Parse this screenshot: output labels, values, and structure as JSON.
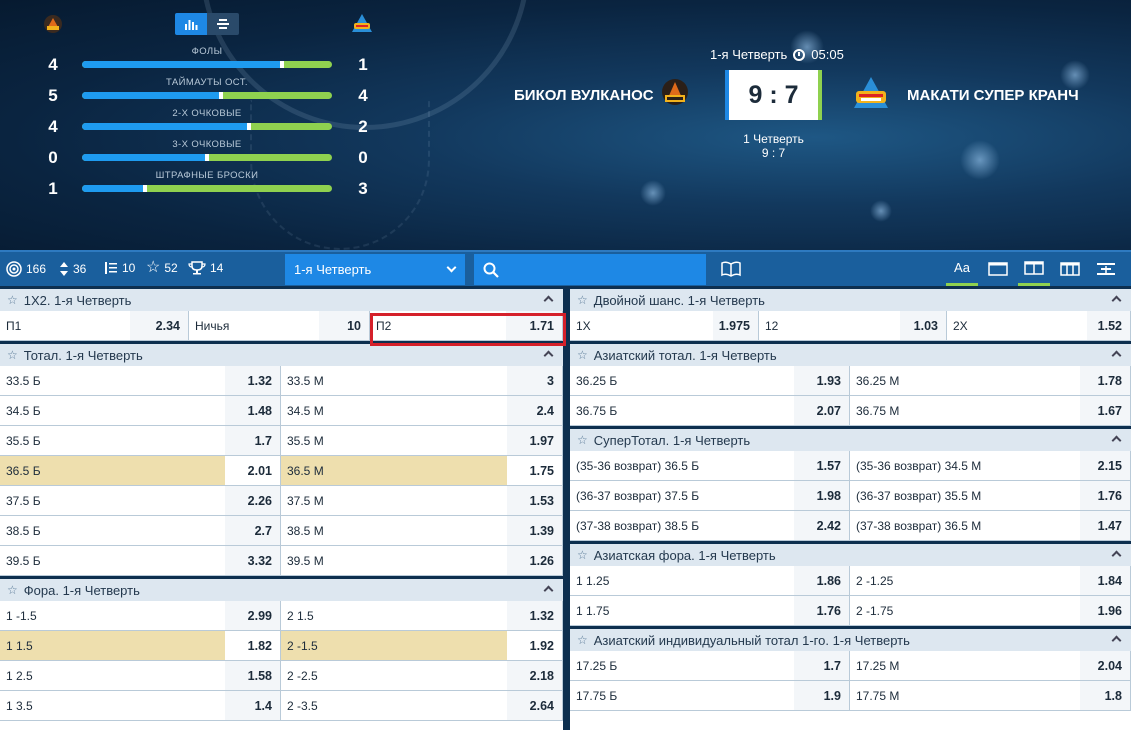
{
  "stats": [
    {
      "label": "ФОЛЫ",
      "left": "4",
      "right": "1",
      "split": 0.8
    },
    {
      "label": "ТАЙМАУТЫ ОСТ.",
      "left": "5",
      "right": "4",
      "split": 0.556
    },
    {
      "label": "2-Х ОЧКОВЫЕ",
      "left": "4",
      "right": "2",
      "split": 0.667
    },
    {
      "label": "3-Х ОЧКОВЫЕ",
      "left": "0",
      "right": "0",
      "split": 0.5
    },
    {
      "label": "ШТРАФНЫЕ БРОСКИ",
      "left": "1",
      "right": "3",
      "split": 0.25
    }
  ],
  "match": {
    "team_home": "БИКОЛ ВУЛКАНОС",
    "team_away": "МАКАТИ СУПЕР КРАНЧ",
    "period": "1-я Четверть",
    "time": "05:05",
    "score": "9 : 7",
    "period_line": "1 Четверть",
    "period_score": "9 : 7"
  },
  "toolbar": {
    "counts": {
      "all": "166",
      "updown": "36",
      "list": "10",
      "fav": "52",
      "cup": "14"
    },
    "period_select": "1-я Четверть",
    "search_placeholder": ""
  },
  "left_markets": [
    {
      "title": "1Х2. 1-я Четверть",
      "type": "three",
      "rows": [
        [
          [
            "П1",
            "2.34"
          ],
          [
            "Ничья",
            "10"
          ],
          [
            "П2",
            "1.71"
          ]
        ]
      ]
    },
    {
      "title": "Тотал. 1-я Четверть",
      "type": "two",
      "hl": [
        3
      ],
      "rows": [
        [
          [
            "33.5 Б",
            "1.32"
          ],
          [
            "33.5 М",
            "3"
          ]
        ],
        [
          [
            "34.5 Б",
            "1.48"
          ],
          [
            "34.5 М",
            "2.4"
          ]
        ],
        [
          [
            "35.5 Б",
            "1.7"
          ],
          [
            "35.5 М",
            "1.97"
          ]
        ],
        [
          [
            "36.5 Б",
            "2.01"
          ],
          [
            "36.5 М",
            "1.75"
          ]
        ],
        [
          [
            "37.5 Б",
            "2.26"
          ],
          [
            "37.5 М",
            "1.53"
          ]
        ],
        [
          [
            "38.5 Б",
            "2.7"
          ],
          [
            "38.5 М",
            "1.39"
          ]
        ],
        [
          [
            "39.5 Б",
            "3.32"
          ],
          [
            "39.5 М",
            "1.26"
          ]
        ]
      ]
    },
    {
      "title": "Фора. 1-я Четверть",
      "type": "two",
      "hl": [
        1
      ],
      "rows": [
        [
          [
            "1 -1.5",
            "2.99"
          ],
          [
            "2 1.5",
            "1.32"
          ]
        ],
        [
          [
            "1 1.5",
            "1.82"
          ],
          [
            "2 -1.5",
            "1.92"
          ]
        ],
        [
          [
            "1 2.5",
            "1.58"
          ],
          [
            "2 -2.5",
            "2.18"
          ]
        ],
        [
          [
            "1 3.5",
            "1.4"
          ],
          [
            "2 -3.5",
            "2.64"
          ]
        ]
      ]
    }
  ],
  "right_markets": [
    {
      "title": "Двойной шанс. 1-я Четверть",
      "type": "three",
      "rows": [
        [
          [
            "1Х",
            "1.975"
          ],
          [
            "12",
            "1.03"
          ],
          [
            "2Х",
            "1.52"
          ]
        ]
      ]
    },
    {
      "title": "Азиатский тотал. 1-я Четверть",
      "type": "two",
      "rows": [
        [
          [
            "36.25 Б",
            "1.93"
          ],
          [
            "36.25 М",
            "1.78"
          ]
        ],
        [
          [
            "36.75 Б",
            "2.07"
          ],
          [
            "36.75 М",
            "1.67"
          ]
        ]
      ]
    },
    {
      "title": "СуперТотал. 1-я Четверть",
      "type": "two",
      "rows": [
        [
          [
            "(35-36 возврат) 36.5 Б",
            "1.57"
          ],
          [
            "(35-36 возврат) 34.5 М",
            "2.15"
          ]
        ],
        [
          [
            "(36-37 возврат) 37.5 Б",
            "1.98"
          ],
          [
            "(36-37 возврат) 35.5 М",
            "1.76"
          ]
        ],
        [
          [
            "(37-38 возврат) 38.5 Б",
            "2.42"
          ],
          [
            "(37-38 возврат) 36.5 М",
            "1.47"
          ]
        ]
      ]
    },
    {
      "title": "Азиатская фора. 1-я Четверть",
      "type": "two",
      "rows": [
        [
          [
            "1 1.25",
            "1.86"
          ],
          [
            "2 -1.25",
            "1.84"
          ]
        ],
        [
          [
            "1 1.75",
            "1.76"
          ],
          [
            "2 -1.75",
            "1.96"
          ]
        ]
      ]
    },
    {
      "title": "Азиатский индивидуальный тотал 1-го. 1-я Четверть",
      "type": "two",
      "rows": [
        [
          [
            "17.25 Б",
            "1.7"
          ],
          [
            "17.25 М",
            "2.04"
          ]
        ],
        [
          [
            "17.75 Б",
            "1.9"
          ],
          [
            "17.75 М",
            "1.8"
          ]
        ]
      ]
    }
  ],
  "colors": {
    "home": "#1e9bf0",
    "away": "#8fd14f",
    "highlight": "#eedfae",
    "selection_border": "#d5202a"
  }
}
